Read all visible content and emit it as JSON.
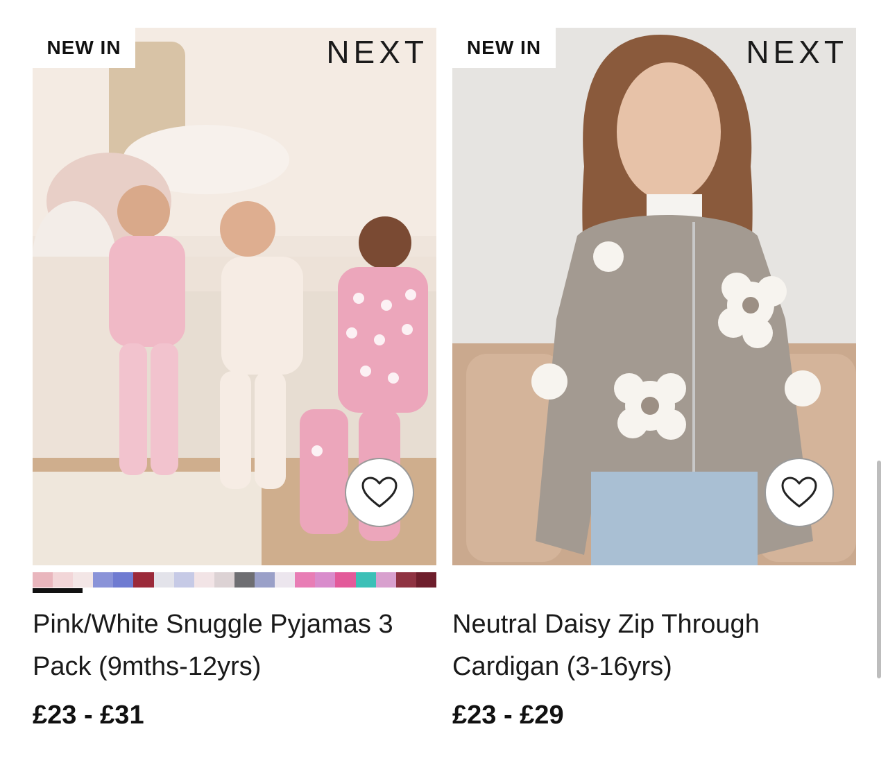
{
  "products": [
    {
      "badge": "NEW IN",
      "brand": "NEXT",
      "title": "Pink/White Snuggle Pyjamas 3 Pack (9mths-12yrs)",
      "price": "£23 - £31",
      "image_alt": "Three children in pink and white pyjamas beside a bed",
      "wishlist_icon": "heart-outline-icon",
      "swatch_colors": [
        "#e9b6bd",
        "#f2d6d8",
        "#f3e6e6",
        "#8a93d8",
        "#6f7bd1",
        "#9b2a3a",
        "#e3e3ea",
        "#c6cae6",
        "#f2e4e6",
        "#dcd2d4",
        "#6e6e72",
        "#9aa0c8",
        "#ece6ee",
        "#e87db5",
        "#d98ccc",
        "#e35a9a",
        "#3cc0b7",
        "#d8a0ce",
        "#8f3342",
        "#6e1e2c"
      ]
    },
    {
      "badge": "NEW IN",
      "brand": "NEXT",
      "title": "Neutral Daisy Zip Through Cardigan (3-16yrs)",
      "price": "£23 - £29",
      "image_alt": "Girl wearing a grey cardigan with white daisy pattern",
      "wishlist_icon": "heart-outline-icon"
    }
  ]
}
